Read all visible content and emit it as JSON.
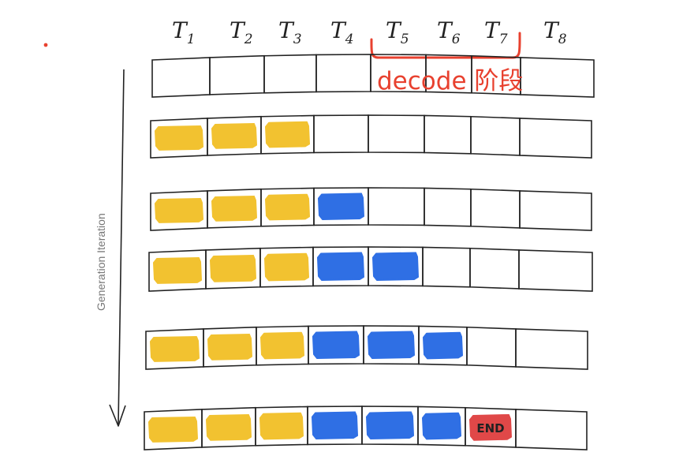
{
  "columns": [
    {
      "base": "T",
      "sub": "1"
    },
    {
      "base": "T",
      "sub": "2"
    },
    {
      "base": "T",
      "sub": "3"
    },
    {
      "base": "T",
      "sub": "4"
    },
    {
      "base": "T",
      "sub": "5"
    },
    {
      "base": "T",
      "sub": "6"
    },
    {
      "base": "T",
      "sub": "7"
    },
    {
      "base": "T",
      "sub": "8"
    }
  ],
  "axis_label": "Generation Iteration",
  "decode_label": "decode 阶段",
  "end_label": "END",
  "colors": {
    "prompt": "#f2c230",
    "generated": "#2f6fe4",
    "end": "#e04848",
    "annotation": "#e8412f",
    "outline": "#222222"
  },
  "rows": [
    [
      "empty",
      "empty",
      "empty",
      "empty",
      "empty",
      "empty",
      "empty",
      "empty"
    ],
    [
      "prompt",
      "prompt",
      "prompt",
      "empty",
      "empty",
      "empty",
      "empty",
      "empty"
    ],
    [
      "prompt",
      "prompt",
      "prompt",
      "generated",
      "empty",
      "empty",
      "empty",
      "empty"
    ],
    [
      "prompt",
      "prompt",
      "prompt",
      "generated",
      "generated",
      "empty",
      "empty",
      "empty"
    ],
    [
      "prompt",
      "prompt",
      "prompt",
      "generated",
      "generated",
      "generated",
      "empty",
      "empty"
    ],
    [
      "prompt",
      "prompt",
      "prompt",
      "generated",
      "generated",
      "generated",
      "end",
      "empty"
    ]
  ]
}
